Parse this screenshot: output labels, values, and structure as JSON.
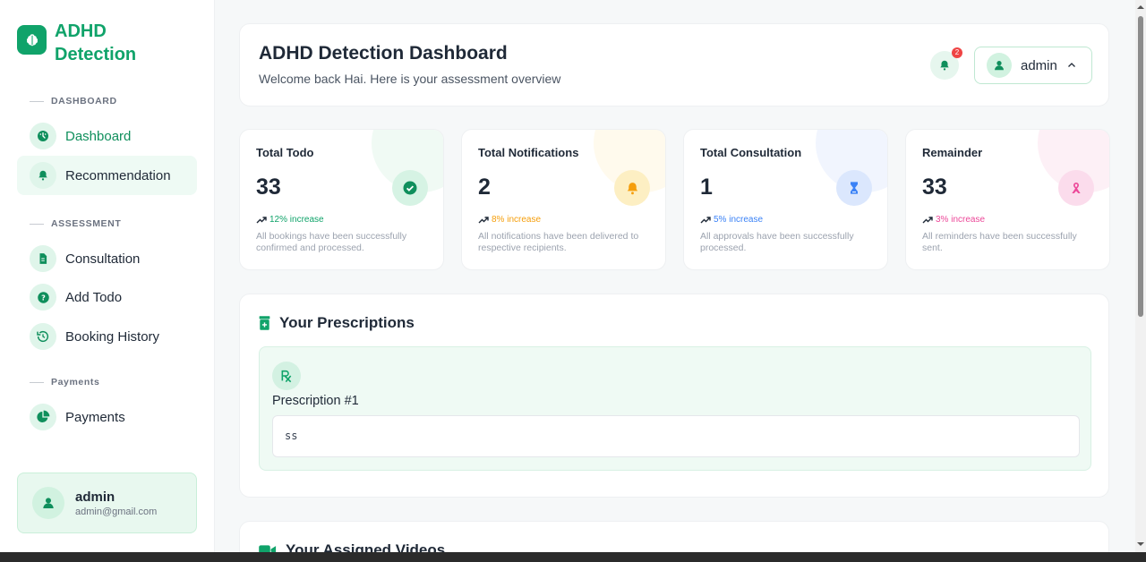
{
  "sidebar": {
    "logo_text": "ADHD Detection",
    "sections": {
      "dashboard": "DASHBOARD",
      "assessment": "ASSESSMENT",
      "payments": "Payments"
    },
    "items": [
      {
        "label": "Dashboard",
        "icon": "dashboard-icon"
      },
      {
        "label": "Recommendation",
        "icon": "bell-icon"
      },
      {
        "label": "Consultation",
        "icon": "document-icon"
      },
      {
        "label": "Add Todo",
        "icon": "question-icon"
      },
      {
        "label": "Booking History",
        "icon": "history-icon"
      },
      {
        "label": "Payments",
        "icon": "pie-chart-icon"
      }
    ],
    "user": {
      "name": "admin",
      "email": "admin@gmail.com"
    }
  },
  "header": {
    "title": "ADHD Detection Dashboard",
    "subtitle": "Welcome back Hai. Here is your assessment overview",
    "notification_count": "2",
    "user_label": "admin"
  },
  "stats": [
    {
      "title": "Total Todo",
      "value": "33",
      "trend": "12% increase",
      "desc": "All bookings have been successfully confirmed and processed.",
      "color": "#10a36a",
      "icon": "check-circle-icon"
    },
    {
      "title": "Total Notifications",
      "value": "2",
      "trend": "8% increase",
      "desc": "All notifications have been delivered to respective recipients.",
      "color": "#f59e0b",
      "icon": "bell-icon"
    },
    {
      "title": "Total Consultation",
      "value": "1",
      "trend": "5% increase",
      "desc": "All approvals have been successfully processed.",
      "color": "#3b82f6",
      "icon": "hourglass-icon"
    },
    {
      "title": "Remainder",
      "value": "33",
      "trend": "3% increase",
      "desc": "All reminders have been successfully sent.",
      "color": "#ec4899",
      "icon": "ribbon-icon"
    }
  ],
  "prescriptions": {
    "title": "Your Prescriptions",
    "items": [
      {
        "name": "Prescription #1",
        "content": "ss"
      }
    ]
  },
  "videos": {
    "title": "Your Assigned Videos"
  },
  "colors": {
    "accent": "#10a36a",
    "accent_light": "#e8f8ef"
  }
}
